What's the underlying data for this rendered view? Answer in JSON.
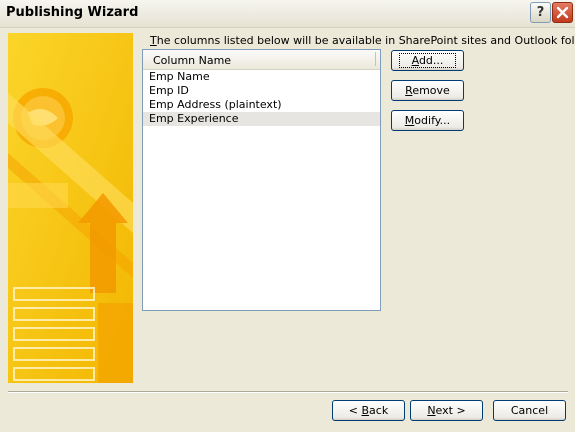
{
  "window": {
    "title": "Publishing Wizard",
    "help_glyph": "?"
  },
  "intro": {
    "first_letter": "T",
    "rest": "he columns listed below will be available in SharePoint sites and Outlook folders."
  },
  "columns_list": {
    "header": "Column Name",
    "items": [
      "Emp Name",
      "Emp ID",
      "Emp Address (plaintext)",
      "Emp Experience"
    ],
    "selected_index": 3
  },
  "side_buttons": {
    "add": {
      "mnemonic": "A",
      "rest": "dd..."
    },
    "remove": {
      "mnemonic": "R",
      "rest": "emove"
    },
    "modify": {
      "pre": "",
      "mnemonic": "M",
      "rest": "odify..."
    }
  },
  "nav_buttons": {
    "back": {
      "pre": "< ",
      "mnemonic": "B",
      "rest": "ack"
    },
    "next": {
      "pre": "",
      "mnemonic": "N",
      "rest": "ext >"
    },
    "cancel": {
      "label": "Cancel"
    }
  },
  "colors": {
    "art_yellow": "#f6c300",
    "art_orange": "#f39a00",
    "art_light": "#ffe07a"
  }
}
